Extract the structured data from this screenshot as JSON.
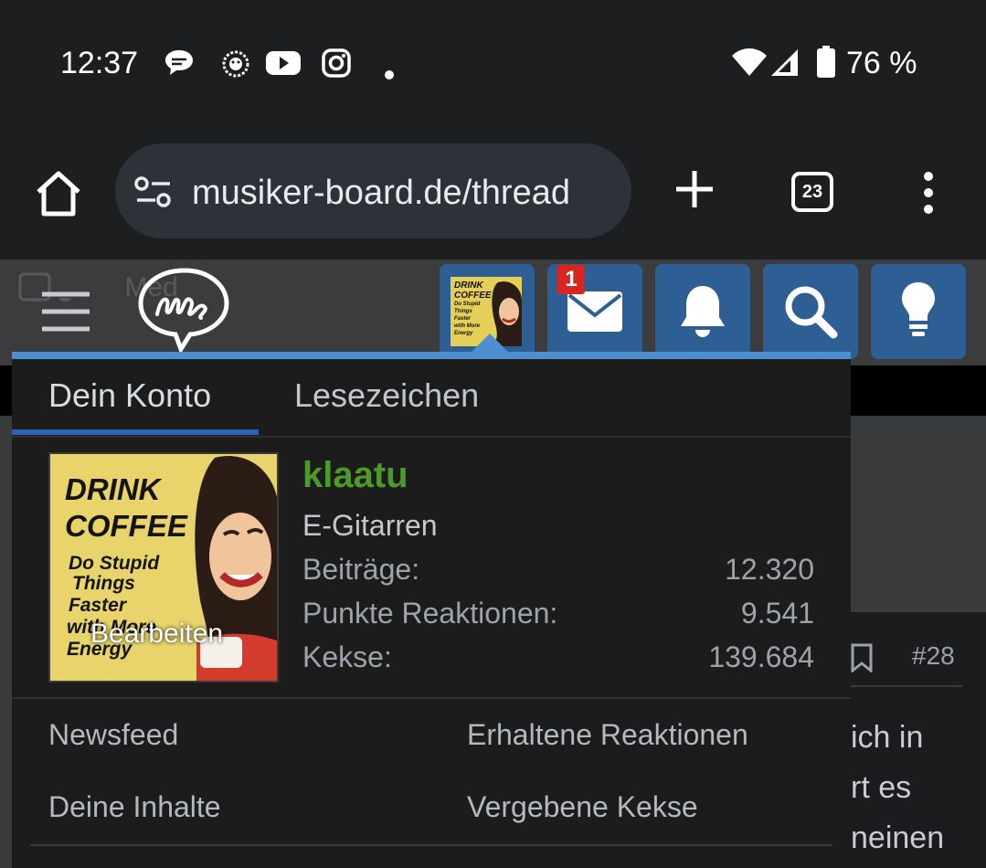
{
  "status_bar": {
    "time": "12:37",
    "battery": "76 %",
    "icons": [
      "chat-bubble-icon",
      "lion-app-icon",
      "youtube-icon",
      "instagram-icon",
      "notification-dot-icon",
      "wifi-icon",
      "signal-icon",
      "battery-icon"
    ]
  },
  "browser": {
    "url": "musiker-board.de/thread",
    "tab_count": "23"
  },
  "header": {
    "ghost_text": "Med",
    "messages_badge": "1",
    "avatar_thumb_text": [
      "DRINK",
      "COFFEE",
      "Do Stupid",
      "Things",
      "Faster",
      "with More",
      "Energy"
    ]
  },
  "dropdown": {
    "tabs": [
      "Dein Konto",
      "Lesezeichen"
    ],
    "avatar": {
      "lines": [
        "DRINK",
        "COFFEE",
        "Do Stupid",
        "Things",
        "Faster",
        "with More",
        "Energy"
      ],
      "edit_label": "Bearbeiten"
    },
    "user": {
      "name": "klaatu",
      "title": "E-Gitarren"
    },
    "stats": [
      {
        "label": "Beiträge:",
        "value": "12.320"
      },
      {
        "label": "Punkte Reaktionen:",
        "value": "9.541"
      },
      {
        "label": "Kekse:",
        "value": "139.684"
      }
    ],
    "links": [
      "Newsfeed",
      "Erhaltene Reaktionen",
      "Deine Inhalte",
      "Vergebene Kekse"
    ]
  },
  "page_behind": {
    "post_number": "#28",
    "lines": [
      "ich in",
      "rt es",
      "neinen"
    ]
  },
  "colors": {
    "accent_blue": "#2d5f94",
    "dropdown_border": "#4d8fd0",
    "username_green": "#4b9a2a",
    "badge_red": "#d8261f"
  }
}
